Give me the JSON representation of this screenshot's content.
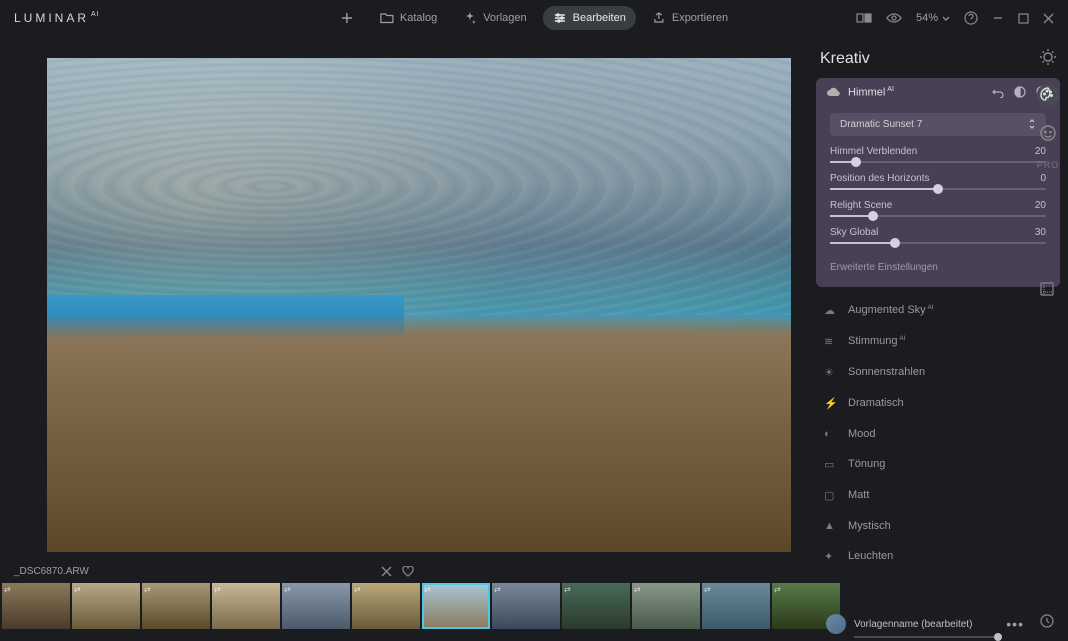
{
  "app": {
    "name": "LUMINAR",
    "suffix": "AI"
  },
  "nav": {
    "katalog": "Katalog",
    "vorlagen": "Vorlagen",
    "bearbeiten": "Bearbeiten",
    "exportieren": "Exportieren"
  },
  "zoom": "54%",
  "filename": "_DSC6870.ARW",
  "sidebar": {
    "title": "Kreativ",
    "sky_panel": {
      "title": "Himmel",
      "title_suffix": "AI",
      "dropdown": "Dramatic Sunset 7",
      "sliders": [
        {
          "label": "Himmel Verblenden",
          "value": "20",
          "pct": 12
        },
        {
          "label": "Position des Horizonts",
          "value": "0",
          "pct": 50
        },
        {
          "label": "Relight Scene",
          "value": "20",
          "pct": 20
        },
        {
          "label": "Sky Global",
          "value": "30",
          "pct": 30
        }
      ],
      "advanced": "Erweiterte Einstellungen"
    },
    "tools": [
      {
        "label": "Augmented Sky",
        "suffix": "AI"
      },
      {
        "label": "Stimmung",
        "suffix": "AI"
      },
      {
        "label": "Sonnenstrahlen",
        "suffix": ""
      },
      {
        "label": "Dramatisch",
        "suffix": ""
      },
      {
        "label": "Mood",
        "suffix": ""
      },
      {
        "label": "Tönung",
        "suffix": ""
      },
      {
        "label": "Matt",
        "suffix": ""
      },
      {
        "label": "Mystisch",
        "suffix": ""
      },
      {
        "label": "Leuchten",
        "suffix": ""
      }
    ]
  },
  "edge": {
    "pro": "PRO"
  },
  "template": {
    "name": "Vorlagenname (bearbeitet)"
  },
  "thumbs": [
    {
      "g": "linear-gradient(#8a7a5a,#4a3a2a)"
    },
    {
      "g": "linear-gradient(#b8a888,#6a5a3a)"
    },
    {
      "g": "linear-gradient(#a89878,#5a4a2a)"
    },
    {
      "g": "linear-gradient(#c8b898,#7a6a4a)"
    },
    {
      "g": "linear-gradient(#8898a8,#4a5a6a)"
    },
    {
      "g": "linear-gradient(#b8a878,#6a5a3a)"
    },
    {
      "g": "linear-gradient(#a8c8d8,#8a7a5a)"
    },
    {
      "g": "linear-gradient(#788898,#3a4a5a)"
    },
    {
      "g": "linear-gradient(#4a6a5a,#2a3a2a)"
    },
    {
      "g": "linear-gradient(#889888,#4a5a4a)"
    },
    {
      "g": "linear-gradient(#6a8a9a,#3a5a6a)"
    },
    {
      "g": "linear-gradient(#5a7a4a,#2a3a1a)"
    }
  ]
}
